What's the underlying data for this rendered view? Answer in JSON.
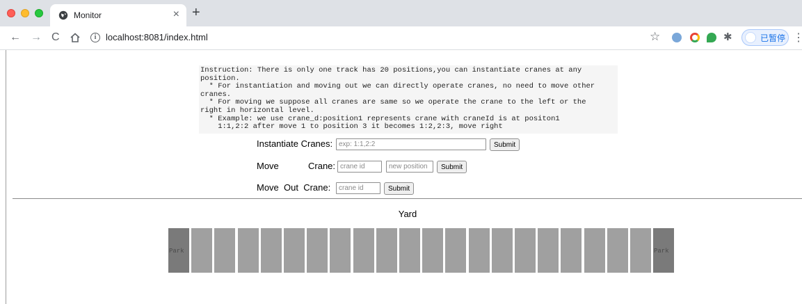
{
  "browser": {
    "tab_title": "Monitor",
    "tab_close": "×",
    "new_tab": "+",
    "url": "localhost:8081/index.html",
    "profile_label": "已暂停",
    "icons": [
      "back-icon",
      "forward-icon",
      "reload-icon",
      "home-icon",
      "info-icon",
      "star-icon",
      "puzzle-icon",
      "menu-icon"
    ]
  },
  "instruction": "Instruction: There is only one track has 20 positions,you can instantiate cranes at any\nposition.\n  * For instantiation and moving out we can directly operate cranes, no need to move other\ncranes.\n  * For moving we suppose all cranes are same so we operate the crane to the left or the\nright in horizontal level.\n  * Example: we use crane_d:position1 represents crane with craneId is at positon1\n    1:1,2:2 after move 1 to position 3 it becomes 1:2,2:3, move right",
  "forms": {
    "instantiate": {
      "label": "Instantiate Cranes:",
      "placeholder": "exp: 1:1,2:2",
      "submit": "Submit"
    },
    "move": {
      "label_move": "Move",
      "label_crane": "Crane:",
      "crane_placeholder": "crane id",
      "position_placeholder": "new position",
      "submit": "Submit"
    },
    "move_out": {
      "label": "Move  Out  Crane:",
      "crane_placeholder": "crane id",
      "submit": "Submit"
    }
  },
  "yard": {
    "title": "Yard",
    "park_label": "Park",
    "positions": 20
  },
  "colors": {
    "park": "#7a7a7a",
    "position": "#a0a0a0"
  }
}
